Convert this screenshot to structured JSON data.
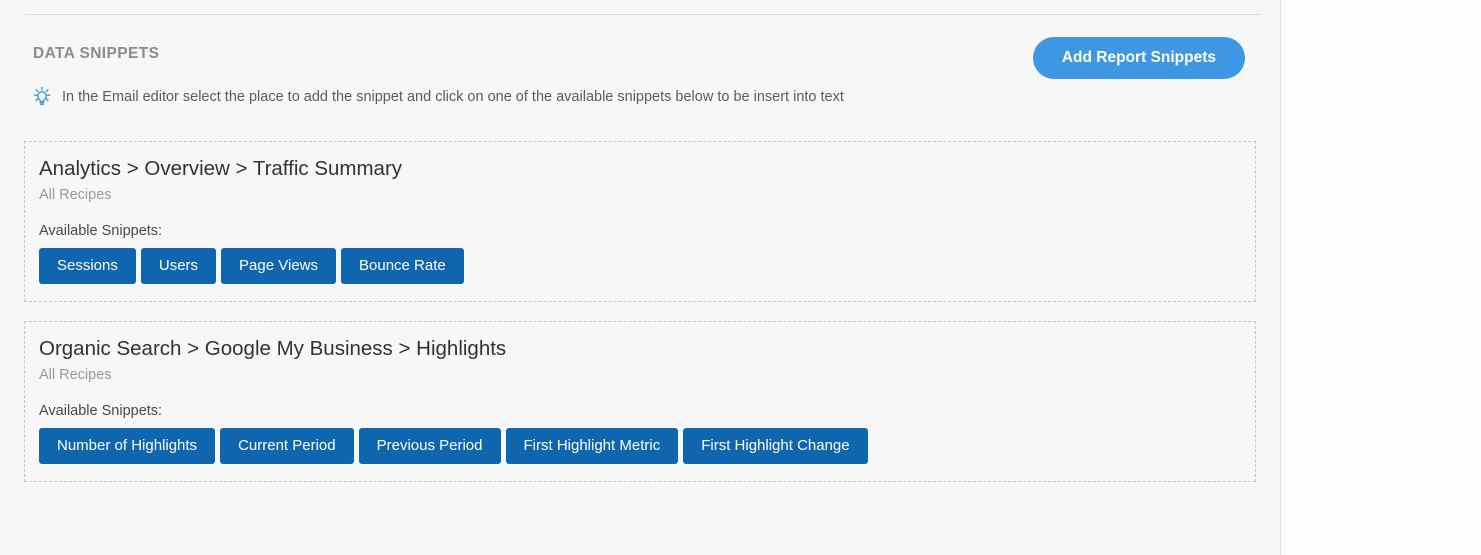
{
  "section": {
    "title": "DATA SNIPPETS",
    "add_button_label": "Add Report Snippets",
    "hint_icon": "lightbulb-icon",
    "hint_text": "In the Email editor select the place to add the snippet and click on one of the available snippets below to be insert into text"
  },
  "labels": {
    "available_snippets": "Available Snippets:"
  },
  "colors": {
    "accent_button": "#3d97e3",
    "chip": "#1066ae",
    "panel_bg": "#f7f7f7",
    "card_border": "#c9c9c9",
    "section_title": "#8c8c8c"
  },
  "cards": [
    {
      "title": "Analytics > Overview > Traffic Summary",
      "subtitle": "All Recipes",
      "available_label": "Available Snippets:",
      "snippets": [
        "Sessions",
        "Users",
        "Page Views",
        "Bounce Rate"
      ]
    },
    {
      "title": "Organic Search > Google My Business > Highlights",
      "subtitle": "All Recipes",
      "available_label": "Available Snippets:",
      "snippets": [
        "Number of Highlights",
        "Current Period",
        "Previous Period",
        "First Highlight Metric",
        "First Highlight Change"
      ]
    }
  ]
}
